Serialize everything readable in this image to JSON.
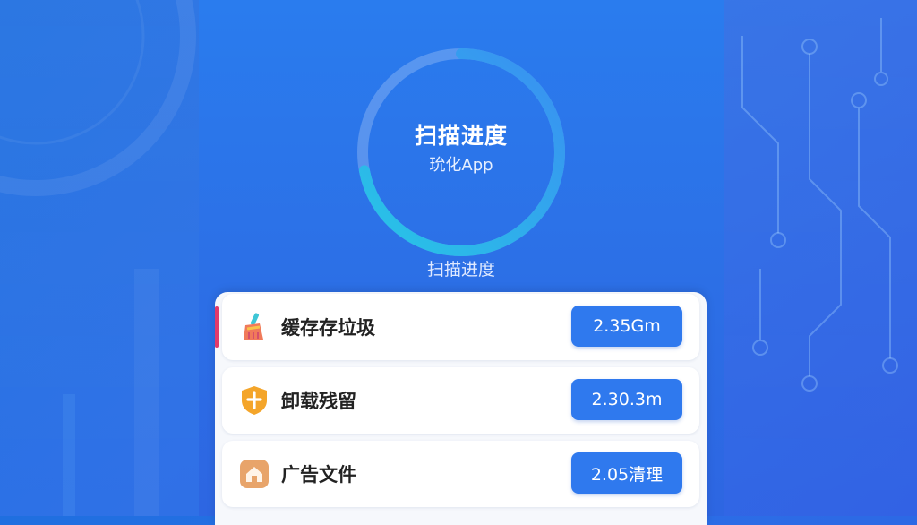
{
  "scan": {
    "title": "扫描进度",
    "subtitle": "玧化App",
    "caption": "扫描进度",
    "progress": 0.72
  },
  "items": [
    {
      "label": "缓存存垃圾",
      "button": "2.35Gm",
      "icon": "broom-icon"
    },
    {
      "label": "卸载残留",
      "button": "2.30.3m",
      "icon": "shield-icon"
    },
    {
      "label": "广告文件",
      "button": "2.05清理",
      "icon": "app-box-icon"
    }
  ],
  "colors": {
    "background": "#2b6ee6",
    "ring_start": "#27c6e6",
    "ring_end": "#3a8ef2",
    "button": "#2f79ee",
    "accent": "#e23a6a"
  }
}
